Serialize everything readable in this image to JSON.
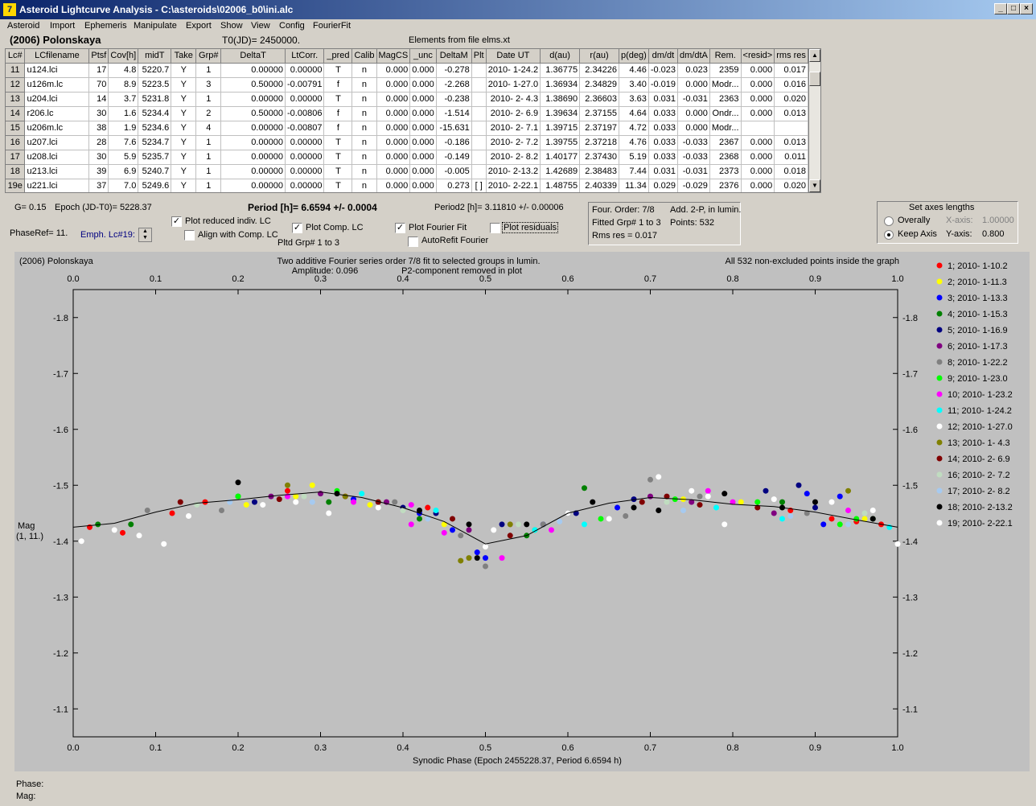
{
  "window": {
    "title": "Asteroid Lightcurve Analysis - C:\\asteroids\\02006_b0\\ini.alc",
    "icon": "app-icon",
    "controls": [
      "_",
      "□",
      "×"
    ]
  },
  "menu": [
    "Asteroid",
    "Import",
    "Ephemeris",
    "Manipulate",
    "Export",
    "Show",
    "View",
    "Config",
    "FourierFit"
  ],
  "header": {
    "asteroid": "(2006) Polonskaya",
    "t0": "T0(JD)= 2450000.",
    "elements": "Elements from file elms.xt"
  },
  "table": {
    "columns": [
      "Lc#",
      "LCfilename",
      "Ptsf",
      "Cov[h]",
      "midT",
      "Take",
      "Grp#",
      "DeltaT",
      "LtCorr.",
      "_pred",
      "Calib",
      "MagCS",
      "_unc",
      "DeltaM",
      "Plt",
      "Date UT",
      "d(au)",
      "r(au)",
      "p(deg)",
      "dm/dt",
      "dm/dtA",
      "Rem.",
      "<resid>",
      "rms res"
    ],
    "rows": [
      [
        "11",
        "u124.lci",
        "17",
        "4.8",
        "5220.7",
        "Y",
        "1",
        "0.00000",
        "0.00000",
        "T",
        "n",
        "0.000",
        "0.000",
        "-0.278",
        "",
        "2010- 1-24.2",
        "1.36775",
        "2.34226",
        "4.46",
        "-0.023",
        "0.023",
        "2359",
        "0.000",
        "0.017"
      ],
      [
        "12",
        "u126m.lc",
        "70",
        "8.9",
        "5223.5",
        "Y",
        "3",
        "0.50000",
        "-0.00791",
        "f",
        "n",
        "0.000",
        "0.000",
        "-2.268",
        "",
        "2010- 1-27.0",
        "1.36934",
        "2.34829",
        "3.40",
        "-0.019",
        "0.000",
        "Modr...",
        "0.000",
        "0.016"
      ],
      [
        "13",
        "u204.lci",
        "14",
        "3.7",
        "5231.8",
        "Y",
        "1",
        "0.00000",
        "0.00000",
        "T",
        "n",
        "0.000",
        "0.000",
        "-0.238",
        "",
        "2010- 2- 4.3",
        "1.38690",
        "2.36603",
        "3.63",
        "0.031",
        "-0.031",
        "2363",
        "0.000",
        "0.020"
      ],
      [
        "14",
        "r206.lc",
        "30",
        "1.6",
        "5234.4",
        "Y",
        "2",
        "0.50000",
        "-0.00806",
        "f",
        "n",
        "0.000",
        "0.000",
        "-1.514",
        "",
        "2010- 2- 6.9",
        "1.39634",
        "2.37155",
        "4.64",
        "0.033",
        "0.000",
        "Ondr...",
        "0.000",
        "0.013"
      ],
      [
        "15",
        "u206m.lc",
        "38",
        "1.9",
        "5234.6",
        "Y",
        "4",
        "0.00000",
        "-0.00807",
        "f",
        "n",
        "0.000",
        "0.000",
        "-15.631",
        "",
        "2010- 2- 7.1",
        "1.39715",
        "2.37197",
        "4.72",
        "0.033",
        "0.000",
        "Modr...",
        "",
        ""
      ],
      [
        "16",
        "u207.lci",
        "28",
        "7.6",
        "5234.7",
        "Y",
        "1",
        "0.00000",
        "0.00000",
        "T",
        "n",
        "0.000",
        "0.000",
        "-0.186",
        "",
        "2010- 2- 7.2",
        "1.39755",
        "2.37218",
        "4.76",
        "0.033",
        "-0.033",
        "2367",
        "0.000",
        "0.013"
      ],
      [
        "17",
        "u208.lci",
        "30",
        "5.9",
        "5235.7",
        "Y",
        "1",
        "0.00000",
        "0.00000",
        "T",
        "n",
        "0.000",
        "0.000",
        "-0.149",
        "",
        "2010- 2- 8.2",
        "1.40177",
        "2.37430",
        "5.19",
        "0.033",
        "-0.033",
        "2368",
        "0.000",
        "0.011"
      ],
      [
        "18",
        "u213.lci",
        "39",
        "6.9",
        "5240.7",
        "Y",
        "1",
        "0.00000",
        "0.00000",
        "T",
        "n",
        "0.000",
        "0.000",
        "-0.005",
        "",
        "2010- 2-13.2",
        "1.42689",
        "2.38483",
        "7.44",
        "0.031",
        "-0.031",
        "2373",
        "0.000",
        "0.018"
      ],
      [
        "19e",
        "u221.lci",
        "37",
        "7.0",
        "5249.6",
        "Y",
        "1",
        "0.00000",
        "0.00000",
        "T",
        "n",
        "0.000",
        "0.000",
        "0.273",
        "[ ]",
        "2010- 2-22.1",
        "1.48755",
        "2.40339",
        "11.34",
        "0.029",
        "-0.029",
        "2376",
        "0.000",
        "0.020"
      ]
    ]
  },
  "params": {
    "g": "G= 0.15",
    "epoch": "Epoch (JD-T0)= 5228.37",
    "period": "Period [h]= 6.6594 +/- 0.0004",
    "period2": "Period2 [h]= 3.11810 +/- 0.00006",
    "phaseref": "PhaseRef= 11.",
    "emph": "Emph. Lc#19:",
    "pltd": "Pltd Grp#  1   to    3"
  },
  "checkboxes": {
    "plot_reduced": {
      "label": "Plot reduced indiv. LC",
      "checked": true
    },
    "align": {
      "label": "Align with Comp. LC",
      "checked": false
    },
    "plot_comp": {
      "label": "Plot Comp. LC",
      "checked": true
    },
    "plot_fourier": {
      "label": "Plot Fourier Fit",
      "checked": true
    },
    "autorefit": {
      "label": "AutoRefit Fourier",
      "checked": false
    },
    "plot_residuals": {
      "label": "Plot residuals",
      "checked": false
    }
  },
  "fourier_info": {
    "order": "Four. Order:  7/8",
    "add": "Add. 2-P, in lumin.",
    "fitted": "Fitted Grp# 1 to 3",
    "points": "Points: 532",
    "rms": "Rms res     = 0.017"
  },
  "axes_box": {
    "title": "Set axes lengths",
    "overally": "Overally",
    "keep": "Keep Axis",
    "xaxis_label": "X-axis:",
    "xaxis_value": "1.00000",
    "yaxis_label": "Y-axis:",
    "yaxis_value": "0.800"
  },
  "chart_data": {
    "type": "scatter",
    "title": "Two additive Fourier series order 7/8 fit to selected groups in lumin.",
    "subtitle": "Amplitude: 0.096",
    "subtitle2": "P2-component removed in plot",
    "object": "(2006) Polonskaya",
    "note": "All 532 non-excluded points inside the graph",
    "xlabel": "Synodic Phase (Epoch 2455228.37, Period 6.6594 h)",
    "ylabel": "Mag",
    "ylabel2": "(1, 11.)",
    "xlim": [
      0,
      1
    ],
    "ylim": [
      -1.85,
      -1.05
    ],
    "y_inverted": true,
    "xticks": [
      "0.0",
      "0.1",
      "0.2",
      "0.3",
      "0.4",
      "0.5",
      "0.6",
      "0.7",
      "0.8",
      "0.9",
      "1.0"
    ],
    "yticks": [
      "-1.8",
      "-1.7",
      "-1.6",
      "-1.5",
      "-1.4",
      "-1.3",
      "-1.2",
      "-1.1"
    ],
    "fit_curve": {
      "x": [
        0.0,
        0.05,
        0.1,
        0.15,
        0.2,
        0.25,
        0.3,
        0.35,
        0.4,
        0.45,
        0.5,
        0.55,
        0.6,
        0.65,
        0.7,
        0.75,
        0.8,
        0.85,
        0.9,
        0.95,
        1.0
      ],
      "y": [
        -1.425,
        -1.432,
        -1.452,
        -1.468,
        -1.474,
        -1.482,
        -1.488,
        -1.478,
        -1.46,
        -1.435,
        -1.395,
        -1.41,
        -1.45,
        -1.468,
        -1.478,
        -1.474,
        -1.466,
        -1.462,
        -1.452,
        -1.438,
        -1.425
      ]
    },
    "series": [
      {
        "name": "1; 2010- 1-10.2",
        "color": "#ff0000",
        "points": [
          [
            0.02,
            -1.425
          ],
          [
            0.06,
            -1.415
          ],
          [
            0.12,
            -1.45
          ],
          [
            0.16,
            -1.47
          ],
          [
            0.26,
            -1.49
          ],
          [
            0.33,
            -1.48
          ],
          [
            0.43,
            -1.46
          ],
          [
            0.87,
            -1.455
          ],
          [
            0.92,
            -1.44
          ],
          [
            0.95,
            -1.435
          ],
          [
            0.98,
            -1.43
          ]
        ]
      },
      {
        "name": "2; 2010- 1-11.3",
        "color": "#ffff00",
        "points": [
          [
            0.21,
            -1.465
          ],
          [
            0.27,
            -1.48
          ],
          [
            0.29,
            -1.5
          ],
          [
            0.36,
            -1.465
          ],
          [
            0.45,
            -1.43
          ],
          [
            0.74,
            -1.475
          ],
          [
            0.81,
            -1.47
          ],
          [
            0.96,
            -1.44
          ]
        ]
      },
      {
        "name": "3; 2010- 1-13.3",
        "color": "#0000ff",
        "points": [
          [
            0.34,
            -1.475
          ],
          [
            0.42,
            -1.45
          ],
          [
            0.46,
            -1.42
          ],
          [
            0.49,
            -1.38
          ],
          [
            0.5,
            -1.37
          ],
          [
            0.57,
            -1.43
          ],
          [
            0.66,
            -1.46
          ],
          [
            0.89,
            -1.485
          ],
          [
            0.93,
            -1.48
          ],
          [
            0.91,
            -1.43
          ]
        ]
      },
      {
        "name": "4; 2010- 1-15.3",
        "color": "#008000",
        "points": [
          [
            0.03,
            -1.43
          ],
          [
            0.07,
            -1.43
          ],
          [
            0.2,
            -1.48
          ],
          [
            0.31,
            -1.47
          ],
          [
            0.42,
            -1.44
          ],
          [
            0.55,
            -1.41
          ],
          [
            0.62,
            -1.495
          ],
          [
            0.86,
            -1.47
          ],
          [
            0.97,
            -1.44
          ]
        ]
      },
      {
        "name": "5; 2010- 1-16.9",
        "color": "#000080",
        "points": [
          [
            0.22,
            -1.47
          ],
          [
            0.4,
            -1.46
          ],
          [
            0.44,
            -1.45
          ],
          [
            0.52,
            -1.43
          ],
          [
            0.61,
            -1.45
          ],
          [
            0.68,
            -1.475
          ],
          [
            0.84,
            -1.49
          ],
          [
            0.88,
            -1.5
          ],
          [
            0.9,
            -1.46
          ]
        ]
      },
      {
        "name": "6; 2010- 1-17.3",
        "color": "#800080",
        "points": [
          [
            0.24,
            -1.48
          ],
          [
            0.3,
            -1.485
          ],
          [
            0.38,
            -1.47
          ],
          [
            0.48,
            -1.42
          ],
          [
            0.7,
            -1.48
          ],
          [
            0.75,
            -1.47
          ],
          [
            0.85,
            -1.45
          ]
        ]
      },
      {
        "name": "8; 2010- 1-22.2",
        "color": "#808080",
        "points": [
          [
            0.09,
            -1.455
          ],
          [
            0.18,
            -1.455
          ],
          [
            0.39,
            -1.47
          ],
          [
            0.47,
            -1.41
          ],
          [
            0.5,
            -1.355
          ],
          [
            0.57,
            -1.43
          ],
          [
            0.67,
            -1.445
          ],
          [
            0.7,
            -1.51
          ],
          [
            0.76,
            -1.48
          ],
          [
            0.89,
            -1.45
          ]
        ]
      },
      {
        "name": "9; 2010- 1-23.0",
        "color": "#00ff00",
        "points": [
          [
            0.2,
            -1.48
          ],
          [
            0.32,
            -1.49
          ],
          [
            0.56,
            -1.42
          ],
          [
            0.64,
            -1.44
          ],
          [
            0.73,
            -1.475
          ],
          [
            0.83,
            -1.47
          ],
          [
            0.93,
            -1.43
          ],
          [
            0.95,
            -1.44
          ]
        ]
      },
      {
        "name": "10; 2010- 1-23.2",
        "color": "#ff00ff",
        "points": [
          [
            0.26,
            -1.48
          ],
          [
            0.34,
            -1.47
          ],
          [
            0.41,
            -1.465
          ],
          [
            0.41,
            -1.43
          ],
          [
            0.45,
            -1.415
          ],
          [
            0.52,
            -1.37
          ],
          [
            0.58,
            -1.42
          ],
          [
            0.77,
            -1.49
          ],
          [
            0.8,
            -1.47
          ],
          [
            0.94,
            -1.455
          ]
        ]
      },
      {
        "name": "11; 2010- 1-24.2",
        "color": "#00ffff",
        "points": [
          [
            0.35,
            -1.485
          ],
          [
            0.44,
            -1.455
          ],
          [
            0.56,
            -1.42
          ],
          [
            0.62,
            -1.43
          ],
          [
            0.78,
            -1.46
          ],
          [
            0.86,
            -1.44
          ],
          [
            0.99,
            -1.425
          ]
        ]
      },
      {
        "name": "12; 2010- 1-27.0",
        "color": "#ffffff",
        "points": [
          [
            0.01,
            -1.4
          ],
          [
            0.08,
            -1.41
          ],
          [
            0.11,
            -1.395
          ],
          [
            0.23,
            -1.465
          ],
          [
            0.31,
            -1.45
          ],
          [
            0.51,
            -1.42
          ],
          [
            0.65,
            -1.44
          ],
          [
            0.71,
            -1.515
          ],
          [
            0.77,
            -1.48
          ],
          [
            0.79,
            -1.43
          ],
          [
            0.92,
            -1.47
          ],
          [
            1.0,
            -1.395
          ]
        ]
      },
      {
        "name": "13; 2010- 1- 4.3",
        "color": "#808000",
        "points": [
          [
            0.26,
            -1.5
          ],
          [
            0.33,
            -1.48
          ],
          [
            0.47,
            -1.365
          ],
          [
            0.48,
            -1.37
          ],
          [
            0.53,
            -1.43
          ],
          [
            0.94,
            -1.49
          ]
        ]
      },
      {
        "name": "14; 2010- 2- 6.9",
        "color": "#800000",
        "points": [
          [
            0.13,
            -1.47
          ],
          [
            0.25,
            -1.475
          ],
          [
            0.37,
            -1.47
          ],
          [
            0.46,
            -1.44
          ],
          [
            0.53,
            -1.41
          ],
          [
            0.69,
            -1.47
          ],
          [
            0.72,
            -1.48
          ],
          [
            0.76,
            -1.465
          ],
          [
            0.83,
            -1.46
          ]
        ]
      },
      {
        "name": "16; 2010- 2- 7.2",
        "color": "#c0dcc0",
        "points": [
          [
            0.15,
            -1.465
          ],
          [
            0.28,
            -1.48
          ],
          [
            0.4,
            -1.455
          ],
          [
            0.54,
            -1.43
          ],
          [
            0.72,
            -1.47
          ],
          [
            0.86,
            -1.46
          ],
          [
            0.96,
            -1.45
          ]
        ]
      },
      {
        "name": "17; 2010- 2- 8.2",
        "color": "#a6caf0",
        "points": [
          [
            0.19,
            -1.47
          ],
          [
            0.29,
            -1.47
          ],
          [
            0.43,
            -1.44
          ],
          [
            0.59,
            -1.435
          ],
          [
            0.74,
            -1.455
          ],
          [
            0.87,
            -1.445
          ],
          [
            0.94,
            -1.43
          ]
        ]
      },
      {
        "name": "18; 2010- 2-13.2",
        "color": "#000000",
        "points": [
          [
            0.2,
            -1.505
          ],
          [
            0.32,
            -1.485
          ],
          [
            0.42,
            -1.455
          ],
          [
            0.48,
            -1.43
          ],
          [
            0.49,
            -1.37
          ],
          [
            0.55,
            -1.43
          ],
          [
            0.6,
            -1.45
          ],
          [
            0.63,
            -1.47
          ],
          [
            0.68,
            -1.46
          ],
          [
            0.71,
            -1.455
          ],
          [
            0.79,
            -1.485
          ],
          [
            0.86,
            -1.46
          ],
          [
            0.9,
            -1.47
          ],
          [
            0.97,
            -1.44
          ]
        ]
      },
      {
        "name": "19; 2010- 2-22.1",
        "color": "#ffffff",
        "points": [
          [
            0.05,
            -1.42
          ],
          [
            0.14,
            -1.445
          ],
          [
            0.27,
            -1.47
          ],
          [
            0.37,
            -1.46
          ],
          [
            0.5,
            -1.39
          ],
          [
            0.6,
            -1.45
          ],
          [
            0.75,
            -1.49
          ],
          [
            0.85,
            -1.475
          ],
          [
            0.97,
            -1.455
          ]
        ]
      }
    ]
  },
  "status": {
    "phase_label": "Phase:",
    "mag_label": "Mag:"
  }
}
